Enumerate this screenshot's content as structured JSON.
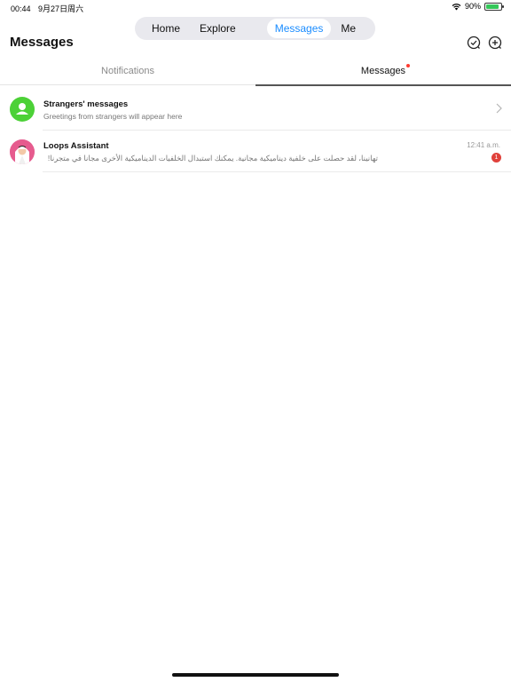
{
  "status_bar": {
    "time": "00:44",
    "date": "9月27日周六",
    "battery_percent": "90%",
    "battery_level": 0.9
  },
  "nav": {
    "home": "Home",
    "explore": "Explore",
    "messages": "Messages",
    "me": "Me",
    "active": "messages",
    "accent": "#1a8cff"
  },
  "header": {
    "title": "Messages",
    "icons": [
      "check-circle-icon",
      "add-chat-icon"
    ]
  },
  "tabs": {
    "notifications": "Notifications",
    "messages": "Messages",
    "active": "messages",
    "unread_dot_color": "#ff3b30"
  },
  "conversations": [
    {
      "title": "Strangers' messages",
      "subtitle": "Greetings from strangers will appear here",
      "icon": "person-icon",
      "color": "#4cd137"
    },
    {
      "title": "Loops Assistant",
      "subtitle": "تهانينا، لقد حصلت على خلفية ديناميكية مجانية. يمكنك استبدال الخلفيات الديناميكية الأخرى مجانا في متجرنا!",
      "time": "12:41 a.m.",
      "badge": "1",
      "badge_color": "#e0413b"
    }
  ]
}
